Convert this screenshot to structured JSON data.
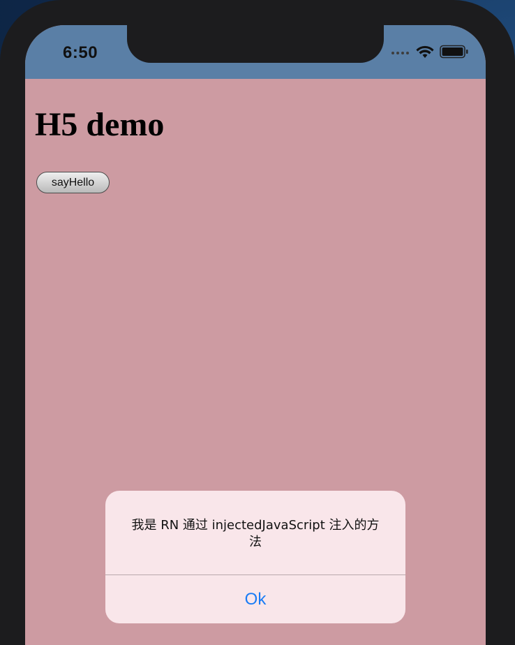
{
  "status_bar": {
    "time": "6:50",
    "icons": [
      "cellular-signal-icon",
      "wifi-icon",
      "battery-icon"
    ]
  },
  "page": {
    "title": "H5 demo",
    "button_label": "sayHello"
  },
  "alert": {
    "message": "我是 RN 通过 injectedJavaScript 注入的方法",
    "ok_label": "Ok"
  },
  "colors": {
    "page_background": "#cd9ba2",
    "status_bar": "#5a7fa6",
    "device_frame": "#1c1c1e",
    "alert_background": "#fae8ec",
    "alert_action": "#1a7cf5"
  }
}
